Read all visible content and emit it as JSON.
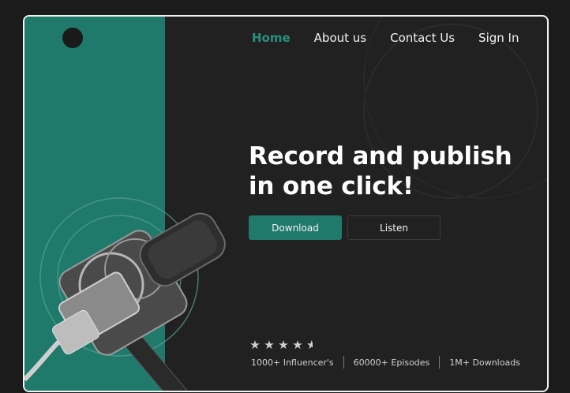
{
  "nav": {
    "items": [
      {
        "label": "Home",
        "active": true
      },
      {
        "label": "About us",
        "active": false
      },
      {
        "label": "Contact Us",
        "active": false
      },
      {
        "label": "Sign In",
        "active": false
      }
    ]
  },
  "hero": {
    "title_line1": "Record and publish",
    "title_line2": "in one click!",
    "download_label": "Download",
    "listen_label": "Listen"
  },
  "rating": {
    "stars": 4.5,
    "max": 5
  },
  "stats": {
    "influencers": "1000+ Influencer's",
    "episodes": "60000+ Episodes",
    "downloads": "1M+ Downloads"
  },
  "colors": {
    "accent": "#1f7a6c",
    "accent_text": "#2a8f7e",
    "background": "#212121",
    "page": "#1b1b1b"
  },
  "icons": {
    "logo": "circle-logo-icon",
    "illustration": "microphone-icon"
  }
}
